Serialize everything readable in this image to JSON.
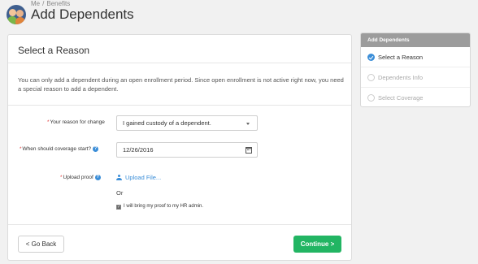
{
  "breadcrumb": {
    "part1": "Me",
    "part2": "Benefits",
    "separator": "/"
  },
  "page_title": "Add Dependents",
  "card": {
    "title": "Select a Reason",
    "info": "You can only add a dependent during an open enrollment period. Since open enrollment is not active right now, you need a special reason to add a dependent."
  },
  "form": {
    "reason_label": "Your reason for change",
    "reason_value": "I gained custody of a dependent.",
    "coverage_label": "When should coverage start?",
    "coverage_value": "12/26/2016",
    "proof_label": "Upload proof",
    "upload_link": "Upload File...",
    "or_text": "Or",
    "checkbox_label": "I will bring my proof to my HR admin.",
    "required_mark": "*",
    "help_glyph": "?"
  },
  "buttons": {
    "back": "< Go Back",
    "continue": "Continue >"
  },
  "steps": {
    "header": "Add Dependents",
    "items": [
      {
        "label": "Select a Reason"
      },
      {
        "label": "Dependents Info"
      },
      {
        "label": "Select Coverage"
      }
    ]
  },
  "colors": {
    "accent": "#3b8ed8",
    "continue": "#22b563",
    "required": "#e04040"
  }
}
